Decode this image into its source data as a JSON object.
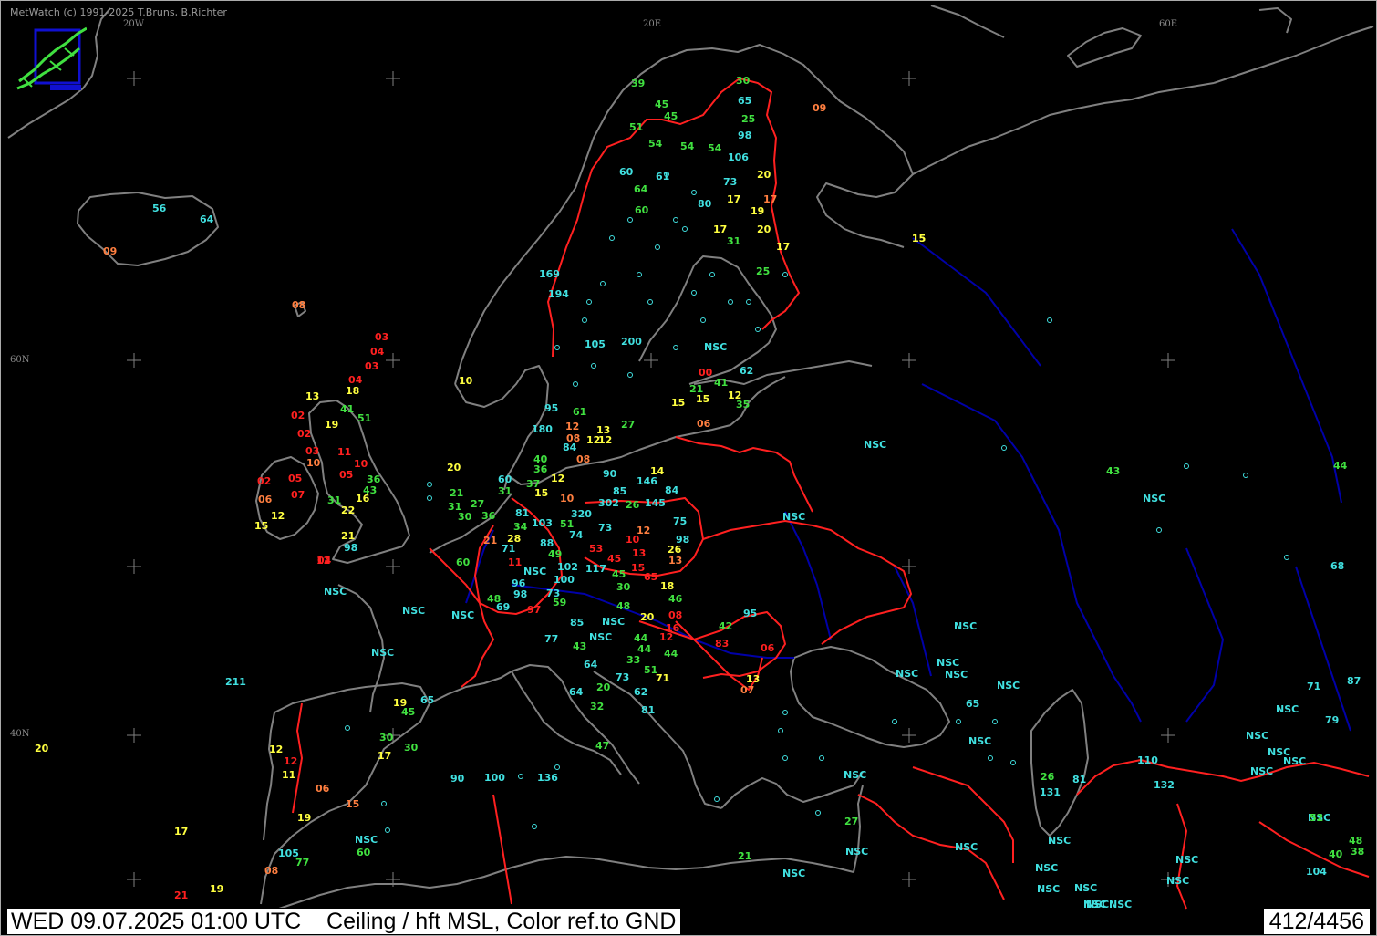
{
  "header": {
    "copyright": "MetWatch  (c) 1991-2025 T.Bruns, B.Richter"
  },
  "grid_labels": [
    {
      "id": "lon-20w",
      "text": "20W"
    },
    {
      "id": "lon-20e",
      "text": "20E"
    },
    {
      "id": "lon-60e",
      "text": "60E"
    },
    {
      "id": "lat-60n",
      "text": "60N"
    },
    {
      "id": "lat-40n",
      "text": "40N"
    }
  ],
  "status_bar": {
    "timestamp": "WED 09.07.2025 01:00 UTC",
    "product": "Ceiling / hft MSL, Color ref.to GND",
    "station_count": "412/4456"
  },
  "colors": {
    "background": "#000000",
    "coastline": "#808080",
    "borders": "#ff2020",
    "rivers": "#0000a8",
    "station_marker": "#40e0e0",
    "ceiling_very_low": "#ff2020",
    "ceiling_low": "#ff7f40",
    "ceiling_moderate": "#ffff40",
    "ceiling_mid": "#40e040",
    "ceiling_high_or_nsc": "#40e0e0"
  },
  "observations": [
    {
      "v": "56",
      "c": "high"
    },
    {
      "v": "64",
      "c": "high"
    },
    {
      "v": "09",
      "c": "low"
    },
    {
      "v": "08",
      "c": "low"
    },
    {
      "v": "03",
      "c": "vlow"
    },
    {
      "v": "04",
      "c": "vlow"
    },
    {
      "v": "03",
      "c": "vlow"
    },
    {
      "v": "04",
      "c": "vlow"
    },
    {
      "v": "13",
      "c": "mod"
    },
    {
      "v": "18",
      "c": "mod"
    },
    {
      "v": "41",
      "c": "mid"
    },
    {
      "v": "02",
      "c": "vlow"
    },
    {
      "v": "19",
      "c": "mod"
    },
    {
      "v": "51",
      "c": "mid"
    },
    {
      "v": "02",
      "c": "vlow"
    },
    {
      "v": "03",
      "c": "vlow"
    },
    {
      "v": "11",
      "c": "vlow"
    },
    {
      "v": "10",
      "c": "low"
    },
    {
      "v": "10",
      "c": "vlow"
    },
    {
      "v": "05",
      "c": "vlow"
    },
    {
      "v": "36",
      "c": "mid"
    },
    {
      "v": "02",
      "c": "vlow"
    },
    {
      "v": "05",
      "c": "vlow"
    },
    {
      "v": "43",
      "c": "mid"
    },
    {
      "v": "06",
      "c": "low"
    },
    {
      "v": "07",
      "c": "vlow"
    },
    {
      "v": "31",
      "c": "mid"
    },
    {
      "v": "16",
      "c": "mod"
    },
    {
      "v": "12",
      "c": "mod"
    },
    {
      "v": "22",
      "c": "mod"
    },
    {
      "v": "15",
      "c": "mod"
    },
    {
      "v": "21",
      "c": "mod"
    },
    {
      "v": "98",
      "c": "high"
    },
    {
      "v": "12",
      "c": "vlow"
    },
    {
      "v": "04",
      "c": "vlow"
    },
    {
      "v": "20",
      "c": "mod"
    },
    {
      "v": "21",
      "c": "mid"
    },
    {
      "v": "31",
      "c": "mid"
    },
    {
      "v": "27",
      "c": "mid"
    },
    {
      "v": "30",
      "c": "mid"
    },
    {
      "v": "36",
      "c": "mid"
    },
    {
      "v": "60",
      "c": "high"
    },
    {
      "v": "31",
      "c": "mid"
    },
    {
      "v": "39",
      "c": "mid"
    },
    {
      "v": "45",
      "c": "mid"
    },
    {
      "v": "45",
      "c": "mid"
    },
    {
      "v": "51",
      "c": "mid"
    },
    {
      "v": "54",
      "c": "mid"
    },
    {
      "v": "54",
      "c": "mid"
    },
    {
      "v": "54",
      "c": "mid"
    },
    {
      "v": "30",
      "c": "mid"
    },
    {
      "v": "65",
      "c": "high"
    },
    {
      "v": "25",
      "c": "mid"
    },
    {
      "v": "98",
      "c": "high"
    },
    {
      "v": "106",
      "c": "high"
    },
    {
      "v": "09",
      "c": "low"
    },
    {
      "v": "60",
      "c": "high"
    },
    {
      "v": "61",
      "c": "high"
    },
    {
      "v": "64",
      "c": "mid"
    },
    {
      "v": "73",
      "c": "high"
    },
    {
      "v": "20",
      "c": "mod"
    },
    {
      "v": "17",
      "c": "mod"
    },
    {
      "v": "17",
      "c": "low"
    },
    {
      "v": "60",
      "c": "mid"
    },
    {
      "v": "80",
      "c": "high"
    },
    {
      "v": "19",
      "c": "mod"
    },
    {
      "v": "17",
      "c": "mod"
    },
    {
      "v": "20",
      "c": "mod"
    },
    {
      "v": "31",
      "c": "mid"
    },
    {
      "v": "17",
      "c": "mod"
    },
    {
      "v": "15",
      "c": "mod"
    },
    {
      "v": "25",
      "c": "mid"
    },
    {
      "v": "169",
      "c": "high"
    },
    {
      "v": "194",
      "c": "high"
    },
    {
      "v": "105",
      "c": "high"
    },
    {
      "v": "200",
      "c": "high"
    },
    {
      "v": "NSC",
      "c": "high"
    },
    {
      "v": "62",
      "c": "high"
    },
    {
      "v": "00",
      "c": "vlow"
    },
    {
      "v": "21",
      "c": "mid"
    },
    {
      "v": "41",
      "c": "mid"
    },
    {
      "v": "12",
      "c": "mod"
    },
    {
      "v": "15",
      "c": "mod"
    },
    {
      "v": "15",
      "c": "mod"
    },
    {
      "v": "35",
      "c": "mid"
    },
    {
      "v": "06",
      "c": "low"
    },
    {
      "v": "10",
      "c": "mod"
    },
    {
      "v": "95",
      "c": "high"
    },
    {
      "v": "61",
      "c": "mid"
    },
    {
      "v": "27",
      "c": "mid"
    },
    {
      "v": "180",
      "c": "high"
    },
    {
      "v": "12",
      "c": "low"
    },
    {
      "v": "13",
      "c": "mod"
    },
    {
      "v": "08",
      "c": "low"
    },
    {
      "v": "12",
      "c": "mod"
    },
    {
      "v": "84",
      "c": "high"
    },
    {
      "v": "08",
      "c": "low"
    },
    {
      "v": "12",
      "c": "mod"
    },
    {
      "v": "40",
      "c": "mid"
    },
    {
      "v": "36",
      "c": "mid"
    },
    {
      "v": "37",
      "c": "mid"
    },
    {
      "v": "12",
      "c": "mod"
    },
    {
      "v": "15",
      "c": "mod"
    },
    {
      "v": "10",
      "c": "low"
    },
    {
      "v": "90",
      "c": "high"
    },
    {
      "v": "146",
      "c": "high"
    },
    {
      "v": "14",
      "c": "mod"
    },
    {
      "v": "85",
      "c": "high"
    },
    {
      "v": "84",
      "c": "high"
    },
    {
      "v": "302",
      "c": "high"
    },
    {
      "v": "26",
      "c": "mid"
    },
    {
      "v": "145",
      "c": "high"
    },
    {
      "v": "81",
      "c": "high"
    },
    {
      "v": "320",
      "c": "high"
    },
    {
      "v": "34",
      "c": "mid"
    },
    {
      "v": "103",
      "c": "high"
    },
    {
      "v": "51",
      "c": "mid"
    },
    {
      "v": "73",
      "c": "high"
    },
    {
      "v": "12",
      "c": "low"
    },
    {
      "v": "75",
      "c": "high"
    },
    {
      "v": "28",
      "c": "mod"
    },
    {
      "v": "21",
      "c": "low"
    },
    {
      "v": "74",
      "c": "high"
    },
    {
      "v": "10",
      "c": "vlow"
    },
    {
      "v": "98",
      "c": "high"
    },
    {
      "v": "71",
      "c": "high"
    },
    {
      "v": "88",
      "c": "high"
    },
    {
      "v": "53",
      "c": "vlow"
    },
    {
      "v": "45",
      "c": "vlow"
    },
    {
      "v": "13",
      "c": "vlow"
    },
    {
      "v": "26",
      "c": "mod"
    },
    {
      "v": "49",
      "c": "mid"
    },
    {
      "v": "60",
      "c": "mid"
    },
    {
      "v": "11",
      "c": "vlow"
    },
    {
      "v": "102",
      "c": "high"
    },
    {
      "v": "NSC",
      "c": "high"
    },
    {
      "v": "117",
      "c": "high"
    },
    {
      "v": "15",
      "c": "vlow"
    },
    {
      "v": "13",
      "c": "low"
    },
    {
      "v": "96",
      "c": "high"
    },
    {
      "v": "100",
      "c": "high"
    },
    {
      "v": "45",
      "c": "mid"
    },
    {
      "v": "65",
      "c": "vlow"
    },
    {
      "v": "30",
      "c": "mid"
    },
    {
      "v": "18",
      "c": "mod"
    },
    {
      "v": "98",
      "c": "high"
    },
    {
      "v": "73",
      "c": "high"
    },
    {
      "v": "48",
      "c": "mid"
    },
    {
      "v": "59",
      "c": "mid"
    },
    {
      "v": "48",
      "c": "mid"
    },
    {
      "v": "46",
      "c": "mid"
    },
    {
      "v": "69",
      "c": "high"
    },
    {
      "v": "97",
      "c": "vlow"
    },
    {
      "v": "08",
      "c": "vlow"
    },
    {
      "v": "20",
      "c": "mod"
    },
    {
      "v": "95",
      "c": "high"
    },
    {
      "v": "85",
      "c": "high"
    },
    {
      "v": "NSC",
      "c": "high"
    },
    {
      "v": "16",
      "c": "vlow"
    },
    {
      "v": "42",
      "c": "mid"
    },
    {
      "v": "77",
      "c": "high"
    },
    {
      "v": "NSC",
      "c": "high"
    },
    {
      "v": "44",
      "c": "mid"
    },
    {
      "v": "12",
      "c": "vlow"
    },
    {
      "v": "43",
      "c": "mid"
    },
    {
      "v": "44",
      "c": "mid"
    },
    {
      "v": "83",
      "c": "vlow"
    },
    {
      "v": "06",
      "c": "vlow"
    },
    {
      "v": "44",
      "c": "mid"
    },
    {
      "v": "33",
      "c": "mid"
    },
    {
      "v": "64",
      "c": "high"
    },
    {
      "v": "51",
      "c": "mid"
    },
    {
      "v": "73",
      "c": "high"
    },
    {
      "v": "71",
      "c": "mod"
    },
    {
      "v": "13",
      "c": "mod"
    },
    {
      "v": "20",
      "c": "mid"
    },
    {
      "v": "62",
      "c": "high"
    },
    {
      "v": "07",
      "c": "low"
    },
    {
      "v": "64",
      "c": "high"
    },
    {
      "v": "32",
      "c": "mid"
    },
    {
      "v": "81",
      "c": "high"
    },
    {
      "v": "47",
      "c": "mid"
    },
    {
      "v": "NSC",
      "c": "high"
    },
    {
      "v": "NSC",
      "c": "high"
    },
    {
      "v": "NSC",
      "c": "high"
    },
    {
      "v": "NSC",
      "c": "high"
    },
    {
      "v": "211",
      "c": "high"
    },
    {
      "v": "19",
      "c": "mod"
    },
    {
      "v": "65",
      "c": "high"
    },
    {
      "v": "45",
      "c": "mid"
    },
    {
      "v": "30",
      "c": "mid"
    },
    {
      "v": "30",
      "c": "mid"
    },
    {
      "v": "17",
      "c": "mod"
    },
    {
      "v": "12",
      "c": "mod"
    },
    {
      "v": "12",
      "c": "vlow"
    },
    {
      "v": "11",
      "c": "mod"
    },
    {
      "v": "06",
      "c": "low"
    },
    {
      "v": "15",
      "c": "low"
    },
    {
      "v": "90",
      "c": "high"
    },
    {
      "v": "100",
      "c": "high"
    },
    {
      "v": "136",
      "c": "high"
    },
    {
      "v": "20",
      "c": "mod"
    },
    {
      "v": "19",
      "c": "mod"
    },
    {
      "v": "17",
      "c": "mod"
    },
    {
      "v": "NSC",
      "c": "high"
    },
    {
      "v": "60",
      "c": "mid"
    },
    {
      "v": "105",
      "c": "high"
    },
    {
      "v": "77",
      "c": "mid"
    },
    {
      "v": "08",
      "c": "low"
    },
    {
      "v": "21",
      "c": "vlow"
    },
    {
      "v": "19",
      "c": "mod"
    },
    {
      "v": "21",
      "c": "mid"
    },
    {
      "v": "NSC",
      "c": "high"
    },
    {
      "v": "27",
      "c": "mid"
    },
    {
      "v": "NSC",
      "c": "high"
    },
    {
      "v": "NSC",
      "c": "high"
    },
    {
      "v": "15",
      "c": "mod"
    },
    {
      "v": "NSC",
      "c": "high"
    },
    {
      "v": "NSC",
      "c": "high"
    },
    {
      "v": "43",
      "c": "mid"
    },
    {
      "v": "44",
      "c": "mid"
    },
    {
      "v": "NSC",
      "c": "high"
    },
    {
      "v": "68",
      "c": "high"
    },
    {
      "v": "NSC",
      "c": "high"
    },
    {
      "v": "NSC",
      "c": "high"
    },
    {
      "v": "NSC",
      "c": "high"
    },
    {
      "v": "NSC",
      "c": "high"
    },
    {
      "v": "NSC",
      "c": "high"
    },
    {
      "v": "65",
      "c": "high"
    },
    {
      "v": "NSC",
      "c": "high"
    },
    {
      "v": "26",
      "c": "mid"
    },
    {
      "v": "81",
      "c": "high"
    },
    {
      "v": "131",
      "c": "high"
    },
    {
      "v": "110",
      "c": "high"
    },
    {
      "v": "132",
      "c": "high"
    },
    {
      "v": "71",
      "c": "high"
    },
    {
      "v": "87",
      "c": "high"
    },
    {
      "v": "NSC",
      "c": "high"
    },
    {
      "v": "79",
      "c": "high"
    },
    {
      "v": "NSC",
      "c": "high"
    },
    {
      "v": "NSC",
      "c": "high"
    },
    {
      "v": "NSC",
      "c": "high"
    },
    {
      "v": "NSC",
      "c": "high"
    },
    {
      "v": "NSC",
      "c": "high"
    },
    {
      "v": "52",
      "c": "mid"
    },
    {
      "v": "48",
      "c": "mid"
    },
    {
      "v": "38",
      "c": "mid"
    },
    {
      "v": "40",
      "c": "mid"
    },
    {
      "v": "104",
      "c": "high"
    },
    {
      "v": "NSC",
      "c": "high"
    },
    {
      "v": "NSC",
      "c": "high"
    },
    {
      "v": "NSC",
      "c": "high"
    },
    {
      "v": "NSC",
      "c": "high"
    },
    {
      "v": "NSC",
      "c": "high"
    },
    {
      "v": "NSC",
      "c": "high"
    },
    {
      "v": "NSC",
      "c": "high"
    },
    {
      "v": "NSC",
      "c": "high"
    },
    {
      "v": "NSC",
      "c": "high"
    },
    {
      "v": "NSC",
      "c": "high"
    }
  ]
}
